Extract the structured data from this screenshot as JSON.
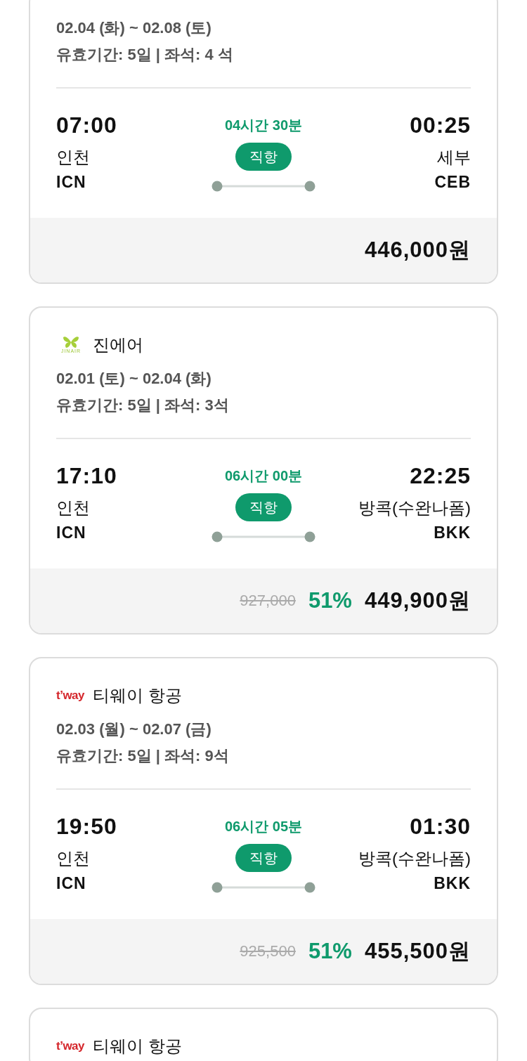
{
  "cards": [
    {
      "dates": "02.04 (화) ~ 02.08 (토)",
      "validity": "유효기간: 5일 | 좌석: 4 석",
      "depart": {
        "time": "07:00",
        "city": "인천",
        "code": "ICN"
      },
      "duration": "04시간 30분",
      "flight_type": "직항",
      "arrive": {
        "time": "00:25",
        "city": "세부",
        "code": "CEB"
      },
      "price": "446,000원"
    },
    {
      "airline": {
        "name": "진에어",
        "kind": "jinair",
        "logo_text": "JINAIR"
      },
      "dates": "02.01 (토) ~ 02.04 (화)",
      "validity": "유효기간: 5일 | 좌석: 3석",
      "depart": {
        "time": "17:10",
        "city": "인천",
        "code": "ICN"
      },
      "duration": "06시간 00분",
      "flight_type": "직항",
      "arrive": {
        "time": "22:25",
        "city": "방콕(수완나폼)",
        "code": "BKK"
      },
      "original_price": "927,000",
      "discount": "51%",
      "price": "449,900원"
    },
    {
      "airline": {
        "name": "티웨이 항공",
        "kind": "tway",
        "logo_text": "t’way"
      },
      "dates": "02.03 (월) ~ 02.07 (금)",
      "validity": "유효기간: 5일 | 좌석: 9석",
      "depart": {
        "time": "19:50",
        "city": "인천",
        "code": "ICN"
      },
      "duration": "06시간 05분",
      "flight_type": "직항",
      "arrive": {
        "time": "01:30",
        "city": "방콕(수완나폼)",
        "code": "BKK"
      },
      "original_price": "925,500",
      "discount": "51%",
      "price": "455,500원"
    },
    {
      "airline": {
        "name": "티웨이 항공",
        "kind": "tway",
        "logo_text": "t’way"
      }
    }
  ]
}
